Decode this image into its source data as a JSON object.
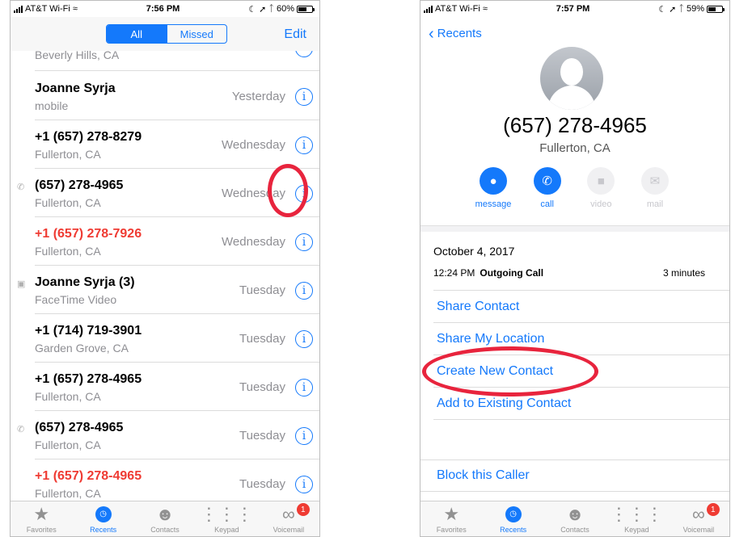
{
  "left": {
    "status": {
      "carrier": "AT&T Wi-Fi",
      "time": "7:56 PM",
      "battery": "60%"
    },
    "segments": {
      "all": "All",
      "missed": "Missed"
    },
    "edit": "Edit",
    "partial_row": "Beverly Hills, CA",
    "calls": [
      {
        "name": "Joanne Syrja",
        "sub": "mobile",
        "when": "Yesterday",
        "missed": false,
        "icon": ""
      },
      {
        "name": "+1 (657) 278-8279",
        "sub": "Fullerton, CA",
        "when": "Wednesday",
        "missed": false,
        "icon": ""
      },
      {
        "name": "(657) 278-4965",
        "sub": "Fullerton, CA",
        "when": "Wednesday",
        "missed": false,
        "icon": "outgoing-call-icon"
      },
      {
        "name": "+1 (657) 278-7926",
        "sub": "Fullerton, CA",
        "when": "Wednesday",
        "missed": true,
        "icon": ""
      },
      {
        "name": "Joanne Syrja (3)",
        "sub": "FaceTime Video",
        "when": "Tuesday",
        "missed": false,
        "icon": "video-icon"
      },
      {
        "name": "+1 (714) 719-3901",
        "sub": "Garden Grove, CA",
        "when": "Tuesday",
        "missed": false,
        "icon": ""
      },
      {
        "name": "+1 (657) 278-4965",
        "sub": "Fullerton, CA",
        "when": "Tuesday",
        "missed": false,
        "icon": ""
      },
      {
        "name": "(657) 278-4965",
        "sub": "Fullerton, CA",
        "when": "Tuesday",
        "missed": false,
        "icon": "outgoing-call-icon"
      },
      {
        "name": "+1 (657) 278-4965",
        "sub": "Fullerton, CA",
        "when": "Tuesday",
        "missed": true,
        "icon": ""
      }
    ],
    "info_glyph": "i"
  },
  "right": {
    "status": {
      "carrier": "AT&T Wi-Fi",
      "time": "7:57 PM",
      "battery": "59%"
    },
    "back": "Recents",
    "number": "(657) 278-4965",
    "location": "Fullerton, CA",
    "actions": [
      {
        "label": "message",
        "enabled": true
      },
      {
        "label": "call",
        "enabled": true
      },
      {
        "label": "video",
        "enabled": false
      },
      {
        "label": "mail",
        "enabled": false
      }
    ],
    "date": "October 4, 2017",
    "call_time": "12:24 PM",
    "call_type": "Outgoing Call",
    "duration": "3 minutes",
    "options": [
      "Share Contact",
      "Share My Location",
      "Create New Contact",
      "Add to Existing Contact"
    ],
    "block": "Block this Caller"
  },
  "tabs": [
    {
      "label": "Favorites",
      "icon": "star-icon"
    },
    {
      "label": "Recents",
      "icon": "clock-icon",
      "active": true
    },
    {
      "label": "Contacts",
      "icon": "contacts-icon"
    },
    {
      "label": "Keypad",
      "icon": "keypad-icon"
    },
    {
      "label": "Voicemail",
      "icon": "voicemail-icon",
      "badge": "1"
    }
  ],
  "colors": {
    "accent": "#1479fb",
    "missed": "#ef3b33",
    "highlight": "#e8243d"
  }
}
